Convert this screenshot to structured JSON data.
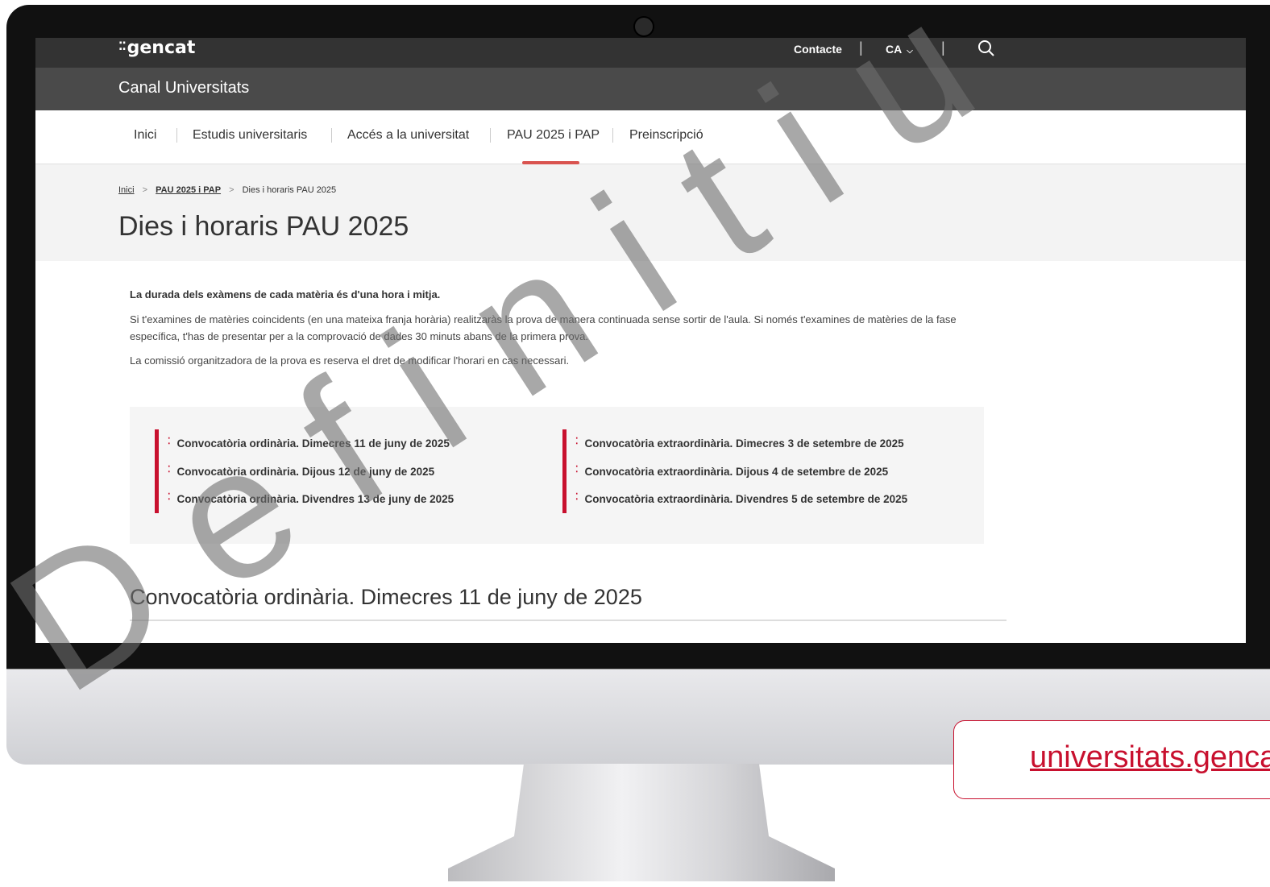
{
  "header": {
    "logo_text": "gencat",
    "contact_label": "Contacte",
    "separator": "|",
    "language_label": "CA"
  },
  "canal": {
    "title": "Canal Universitats"
  },
  "nav": {
    "items": [
      {
        "label": "Inici"
      },
      {
        "label": "Estudis universitaris"
      },
      {
        "label": "Accés a la universitat"
      },
      {
        "label": "PAU 2025 i PAP"
      },
      {
        "label": "Preinscripció"
      }
    ],
    "active_item": "PAU 2025 i PAP"
  },
  "breadcrumb": {
    "items": [
      "Inici",
      "PAU 2025 i PAP",
      "Dies i horaris PAU 2025"
    ]
  },
  "page": {
    "title": "Dies i horaris PAU 2025",
    "intro_bold": "La durada dels exàmens de cada matèria és d'una hora i mitja.",
    "paragraph_1": "Si t'examines de matèries coincidents (en una mateixa franja horària) realitzaràs la prova de manera continuada sense sortir de l'aula. Si només t'examines de matèries de la fase específica, t'has de presentar per a la comprovació de dades 30 minuts abans de la primera prova.",
    "paragraph_2": "La comissió organitzadora de la prova es reserva el dret de modificar l'horari en cas necessari."
  },
  "sessions": {
    "ordinary": [
      "Convocatòria ordinària. Dimecres 11 de juny de 2025",
      "Convocatòria ordinària. Dijous 12 de juny de 2025",
      "Convocatòria ordinària. Divendres 13 de juny de 2025"
    ],
    "extraordinary": [
      "Convocatòria extraordinària. Dimecres 3 de setembre de 2025",
      "Convocatòria extraordinària. Dijous 4 de setembre de 2025",
      "Convocatòria extraordinària. Divendres 5 de setembre de 2025"
    ]
  },
  "section": {
    "heading": "Convocatòria ordinària. Dimecres 11 de juny de 2025"
  },
  "overlay": {
    "watermark": "Definitiu",
    "url_label": "universitats.gencat.cat"
  },
  "colors": {
    "accent_red": "#c8102e",
    "topbar": "#333333",
    "canal_bar": "#4a4a4a",
    "nav_active_underline": "#d9534f"
  },
  "icons": {
    "search": "search-icon",
    "language_chevron": "chevron-down-icon",
    "breadcrumb_separator": "chevron-right-icon",
    "session_bullet": "gencat-mark-icon"
  }
}
